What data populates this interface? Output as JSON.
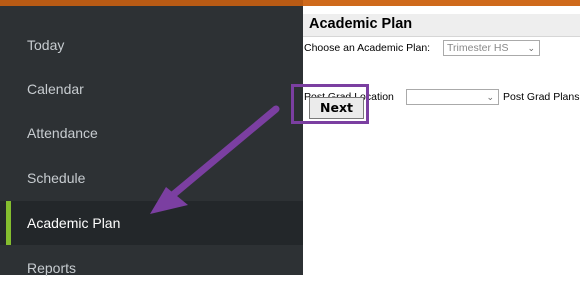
{
  "sidebar": {
    "items": [
      {
        "label": "Today"
      },
      {
        "label": "Calendar"
      },
      {
        "label": "Attendance"
      },
      {
        "label": "Schedule"
      },
      {
        "label": "Academic Plan",
        "active": true
      },
      {
        "label": "Reports"
      }
    ]
  },
  "main": {
    "title": "Academic Plan",
    "choose_label": "Choose an Academic Plan:",
    "plan_select_value": "Trimester HS",
    "post_grad_location_label": "Post Grad Location",
    "post_grad_location_value": "",
    "post_grad_plans_label": "Post Grad Plans",
    "next_label": "Next"
  },
  "colors": {
    "top_accent": "#cf6a1c",
    "sidebar_bg": "#2d3134",
    "active_indicator": "#84bd2f",
    "annotation": "#7b3fa1"
  },
  "annotation": {
    "type": "arrow-and-box",
    "icons": [
      "chevron-down-icon"
    ]
  }
}
